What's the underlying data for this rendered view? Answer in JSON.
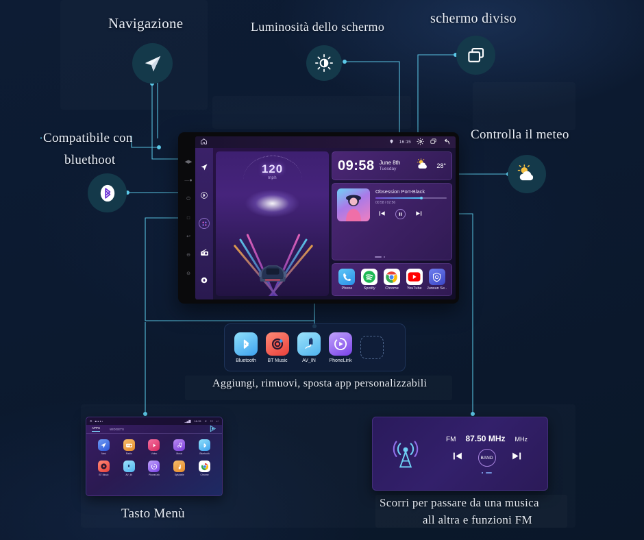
{
  "theme": {
    "bg": "#0c1a30",
    "accent_line": "#5cc9e8",
    "badge_bg": "#14394a",
    "label_color": "#e9eef6"
  },
  "annotations": {
    "navigation": "Navigazione",
    "brightness": "Luminosità dello schermo",
    "split_screen": "schermo diviso",
    "bluetooth": "Compatibile con\nbluethoot",
    "bluetooth_line1": "Compatibile con",
    "bluetooth_line2": "bluethoot",
    "weather": "Controlla il meteo",
    "custom_apps": "Aggiungi, rimuovi, sposta app personalizzabili",
    "menu_button": "Tasto Menù",
    "radio_line1": "Scorri per passare da una musica",
    "radio_line2": "all altra e funzioni FM"
  },
  "badges": [
    {
      "name": "navigation-icon",
      "icon": "navigation-arrow"
    },
    {
      "name": "brightness-icon",
      "icon": "sun-brightness"
    },
    {
      "name": "split-screen-icon",
      "icon": "two-rectangles"
    },
    {
      "name": "bluetooth-icon",
      "icon": "bluetooth"
    },
    {
      "name": "weather-icon",
      "icon": "sun-cloud"
    }
  ],
  "head_unit": {
    "status_bar": {
      "home_icon": "home-outline",
      "location_icon": "location-pin",
      "clock": "16:15",
      "brightness_icon": "sun-brightness",
      "recents_icon": "recents-square",
      "back_icon": "back-arrow"
    },
    "rail": [
      {
        "name": "rail-navigation",
        "icon": "navigation-arrow"
      },
      {
        "name": "rail-bluetooth",
        "icon": "bluetooth"
      },
      {
        "name": "rail-apps",
        "icon": "grid-dots"
      },
      {
        "name": "rail-radio",
        "icon": "radio"
      },
      {
        "name": "rail-power",
        "icon": "circle-dot"
      }
    ],
    "side_buttons": [
      "◄►",
      "−",
      "⏻",
      "⌂",
      "↩",
      "⊕",
      "⊖"
    ],
    "drive": {
      "speed": "120",
      "unit": "mph"
    },
    "clock_card": {
      "time": "09:58",
      "date": "June 8th",
      "weekday": "Tuesday",
      "temperature": "28°",
      "weather_icon": "sun-cloud"
    },
    "music_card": {
      "track": "Obsession Port-Black",
      "elapsed_total": "00:58 / 02:56",
      "progress_percent": 64,
      "prev_icon": "skip-previous",
      "play_icon": "pause",
      "next_icon": "skip-next"
    },
    "app_dock": [
      {
        "label": "Phone",
        "icon": "phone",
        "color": "#35a9f5"
      },
      {
        "label": "Spotify",
        "icon": "spotify",
        "color": "#1db954"
      },
      {
        "label": "Chrome",
        "icon": "chrome",
        "color": "#ffffff"
      },
      {
        "label": "YouTube",
        "icon": "youtube",
        "color": "#ff0000"
      },
      {
        "label": "Junsun Se..",
        "icon": "shield",
        "color": "#4a5cd6"
      }
    ]
  },
  "custom_strip": {
    "items": [
      {
        "label": "Bluetooth",
        "icon": "bluetooth",
        "color": "#63c8f7"
      },
      {
        "label": "BT Music",
        "icon": "vinyl-record",
        "color": "#f2605c"
      },
      {
        "label": "AV_IN",
        "icon": "av-cable",
        "color": "#6ec7f2"
      },
      {
        "label": "PhoneLink",
        "icon": "play-circle",
        "color": "#9b63f0"
      }
    ],
    "empty_slot": true
  },
  "menu_screen": {
    "status": {
      "left_icons": "settings-bars",
      "clock": "16:15"
    },
    "tabs": [
      {
        "label": "APPS",
        "active": true
      },
      {
        "label": "WIDGETS",
        "active": false
      }
    ],
    "play_icon": "play-badge",
    "apps": [
      {
        "label": "Navi",
        "icon": "navigation-arrow",
        "color": "#3d7bf0"
      },
      {
        "label": "Radio",
        "icon": "radio",
        "color": "#f0a23c"
      },
      {
        "label": "Video",
        "icon": "play-circle",
        "color": "#e8437e"
      },
      {
        "label": "Music",
        "icon": "music-note",
        "color": "#a15ef0"
      },
      {
        "label": "Bluetooth",
        "icon": "bluetooth",
        "color": "#4fb8f5"
      },
      {
        "label": "BT Music",
        "icon": "vinyl-record",
        "color": "#f2605c"
      },
      {
        "label": "AV_IN",
        "icon": "av-cable",
        "color": "#5ec3f5"
      },
      {
        "label": "PhoneLink",
        "icon": "play-circle",
        "color": "#9b63f0"
      },
      {
        "label": "SpMobile",
        "icon": "hand-app",
        "color": "#f0a23c"
      },
      {
        "label": "Chrome",
        "icon": "chrome",
        "color": "#ffffff"
      }
    ]
  },
  "radio_screen": {
    "tower_icon": "radio-tower",
    "band": "FM",
    "frequency": "87.50 MHz",
    "unit": "MHz",
    "prev_icon": "skip-previous",
    "band_button": "BAND",
    "next_icon": "skip-next"
  }
}
